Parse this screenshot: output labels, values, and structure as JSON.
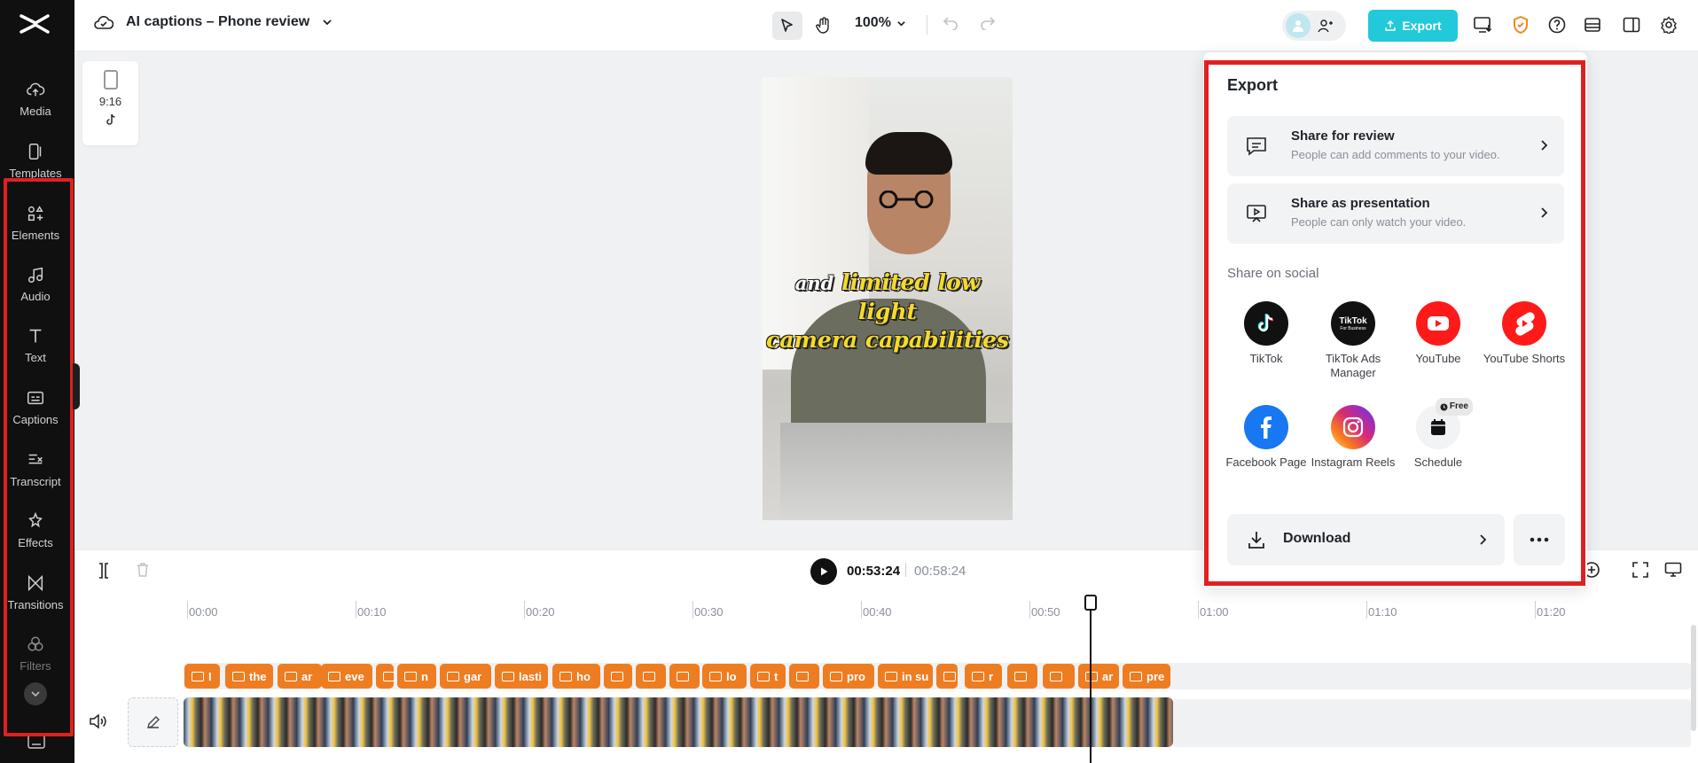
{
  "header": {
    "project_title": "AI captions – Phone review",
    "zoom": "100%",
    "export_label": "Export"
  },
  "sidebar": {
    "items": [
      {
        "label": "Media",
        "icon": "cloud-upload-icon"
      },
      {
        "label": "Templates",
        "icon": "templates-icon"
      },
      {
        "label": "Elements",
        "icon": "elements-icon"
      },
      {
        "label": "Audio",
        "icon": "music-note-icon"
      },
      {
        "label": "Text",
        "icon": "text-icon"
      },
      {
        "label": "Captions",
        "icon": "captions-icon"
      },
      {
        "label": "Transcript",
        "icon": "transcript-icon"
      },
      {
        "label": "Effects",
        "icon": "effects-icon"
      },
      {
        "label": "Transitions",
        "icon": "transitions-icon"
      },
      {
        "label": "Filters",
        "icon": "filters-icon"
      }
    ]
  },
  "canvas": {
    "aspect_ratio": "9:16",
    "caption_line1_lead": "and",
    "caption_line1_main": "limited low light",
    "caption_line2": "camera capabilities"
  },
  "export_panel": {
    "title": "Export",
    "share_review": {
      "title": "Share for review",
      "subtitle": "People can add comments to your video."
    },
    "share_presentation": {
      "title": "Share as presentation",
      "subtitle": "People can only watch your video."
    },
    "social_label": "Share on social",
    "socials": [
      {
        "name": "TikTok",
        "color": "#111111"
      },
      {
        "name": "TikTok Ads Manager",
        "color": "#111111"
      },
      {
        "name": "YouTube",
        "color": "#ff1a1a"
      },
      {
        "name": "YouTube Shorts",
        "color": "#ff1a1a"
      },
      {
        "name": "Facebook Page",
        "color": "#1877f2"
      },
      {
        "name": "Instagram Reels",
        "color": "#d62976"
      },
      {
        "name": "Schedule",
        "color": "#f2f3f5"
      }
    ],
    "schedule_badge": "Free",
    "download_label": "Download"
  },
  "playback": {
    "current_time": "00:53:24",
    "total_time": "00:58:24"
  },
  "timeline": {
    "ruler": [
      "00:00",
      "00:10",
      "00:20",
      "00:30",
      "00:40",
      "00:50",
      "01:00",
      "01:10",
      "01:20"
    ],
    "caption_clips": [
      "I",
      "the",
      "ar",
      "eve",
      "(",
      "n",
      "gar",
      "lasti",
      "ho",
      "",
      "",
      "",
      "lo",
      "t",
      "",
      "pro",
      "in su",
      "",
      "r",
      "",
      "",
      "ar",
      "pre"
    ]
  },
  "colors": {
    "accent": "#22c9d9",
    "highlight": "#e02020",
    "caption_clip": "#ee7d22"
  }
}
